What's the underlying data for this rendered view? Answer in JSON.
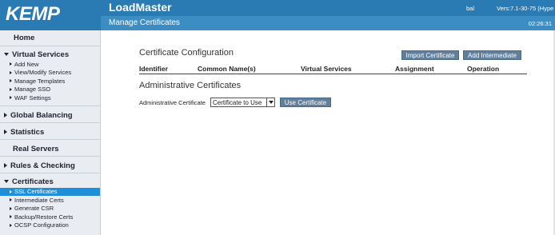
{
  "logo": {
    "text": "KEMP"
  },
  "header": {
    "app_title": "LoadMaster",
    "user": "bal",
    "version": "Vers:7.1-30-75 (Hype",
    "page_title": "Manage Certificates",
    "clock": "02:26:31"
  },
  "sidebar": {
    "home": "Home",
    "sections": [
      {
        "label": "Virtual Services",
        "expanded": true,
        "items": [
          "Add New",
          "View/Modify Services",
          "Manage Templates",
          "Manage SSO",
          "WAF Settings"
        ]
      },
      {
        "label": "Global Balancing",
        "expanded": false
      },
      {
        "label": "Statistics",
        "expanded": false
      },
      {
        "label": "Real Servers"
      },
      {
        "label": "Rules & Checking",
        "expanded": false
      },
      {
        "label": "Certificates",
        "expanded": true,
        "items": [
          "SSL Certificates",
          "Intermediate Certs",
          "Generate CSR",
          "Backup/Restore Certs",
          "OCSP Configuration"
        ],
        "active_item": "SSL Certificates"
      }
    ]
  },
  "main": {
    "cert_config_title": "Certificate Configuration",
    "import_button": "Import Certificate",
    "add_intermediate_button": "Add Intermediate",
    "columns": [
      "Identifier",
      "Common Name(s)",
      "Virtual Services",
      "Assignment",
      "Operation"
    ],
    "admin_title": "Administrative Certificates",
    "admin_label": "Administrative Certificate",
    "admin_select_value": "Certificate to Use",
    "use_cert_button": "Use Certificate"
  },
  "colors": {
    "header_bg": "#2a7ab3",
    "subheader_bg": "#3c8dc4",
    "sidebar_bg": "#e9edf1",
    "active_item_bg": "#1e8fd8",
    "button_bg": "#5f7f9c"
  }
}
